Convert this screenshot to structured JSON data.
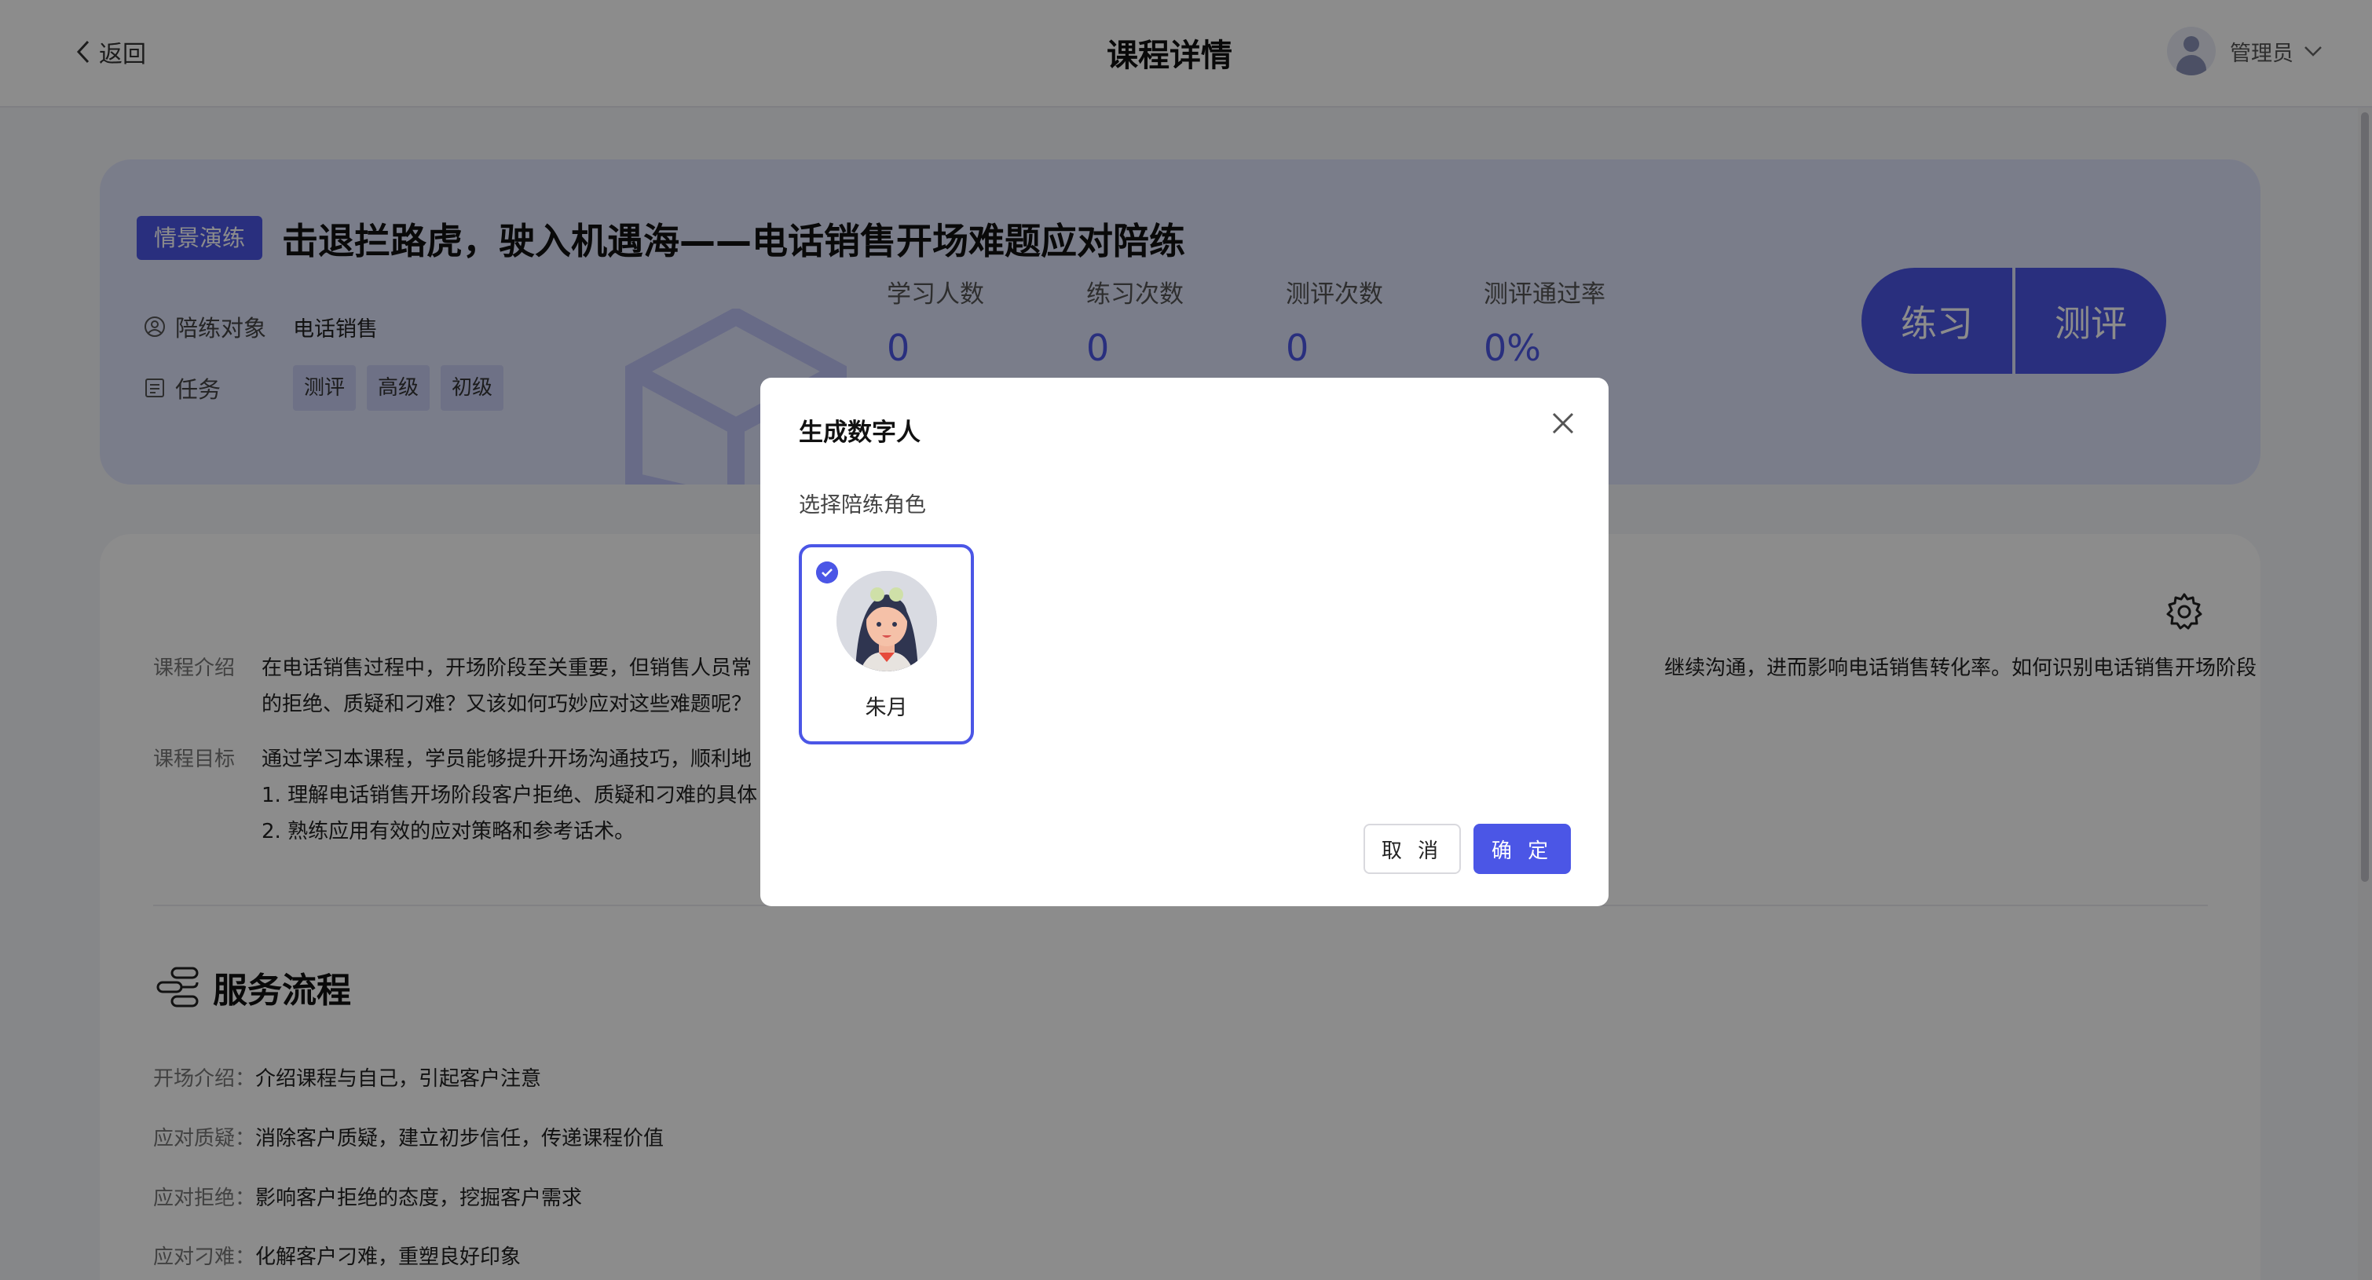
{
  "header": {
    "back_label": "返回",
    "title": "课程详情",
    "user_name": "管理员"
  },
  "banner": {
    "type_tag": "情景演练",
    "course_title": "击退拦路虎，驶入机遇海——电话销售开场难题应对陪练",
    "partner_label": "陪练对象",
    "partner_value": "电话销售",
    "task_label": "任务",
    "task_tags": [
      "测评",
      "高级",
      "初级"
    ],
    "stats": [
      {
        "label": "学习人数",
        "value": "0"
      },
      {
        "label": "练习次数",
        "value": "0"
      },
      {
        "label": "测评次数",
        "value": "0"
      },
      {
        "label": "测评通过率",
        "value": "0%"
      }
    ],
    "practice_button": "练习",
    "evaluate_button": "测评"
  },
  "content": {
    "intro_label": "课程介绍",
    "intro_line1_left": "在电话销售过程中，开场阶段至关重要，但销售人员常",
    "intro_line1_right": "继续沟通，进而影响电话销售转化率。如何识别电话销售开场阶段",
    "intro_line2": "的拒绝、质疑和刁难？又该如何巧妙应对这些难题呢？",
    "goal_label": "课程目标",
    "goal_line1": "通过学习本课程，学员能够提升开场沟通技巧，顺利地",
    "goal_line2": "1. 理解电话销售开场阶段客户拒绝、质疑和刁难的具体",
    "goal_line3": "2. 熟练应用有效的应对策略和参考话术。",
    "flow_title": "服务流程",
    "flow": [
      {
        "k": "开场介绍：",
        "v": "介绍课程与自己，引起客户注意"
      },
      {
        "k": "应对质疑：",
        "v": "消除客户质疑，建立初步信任，传递课程价值"
      },
      {
        "k": "应对拒绝：",
        "v": "影响客户拒绝的态度，挖掘客户需求"
      },
      {
        "k": "应对刁难：",
        "v": "化解客户刁难，重塑良好印象"
      }
    ]
  },
  "modal": {
    "title": "生成数字人",
    "subtitle": "选择陪练角色",
    "role_name": "朱月",
    "cancel": "取 消",
    "confirm": "确 定"
  },
  "colors": {
    "accent": "#4b56e6",
    "banner_bg": "#dfe3fb"
  }
}
